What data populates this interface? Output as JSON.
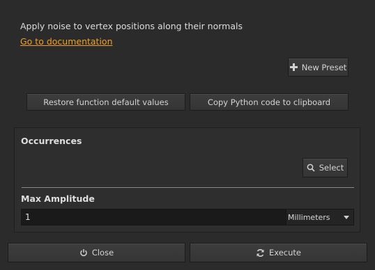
{
  "description": "Apply noise to vertex positions along their normals",
  "doc_link": "Go to documentation",
  "toolbar": {
    "new_preset": "New Preset",
    "restore_defaults": "Restore function default values",
    "copy_python": "Copy Python code to clipboard"
  },
  "occurrences": {
    "title": "Occurrences",
    "select_label": "Select"
  },
  "max_amplitude": {
    "title": "Max Amplitude",
    "value": "1",
    "unit": "Millimeters"
  },
  "footer": {
    "close": "Close",
    "execute": "Execute"
  },
  "colors": {
    "background": "#2b2b2b",
    "link": "#f0a020"
  }
}
